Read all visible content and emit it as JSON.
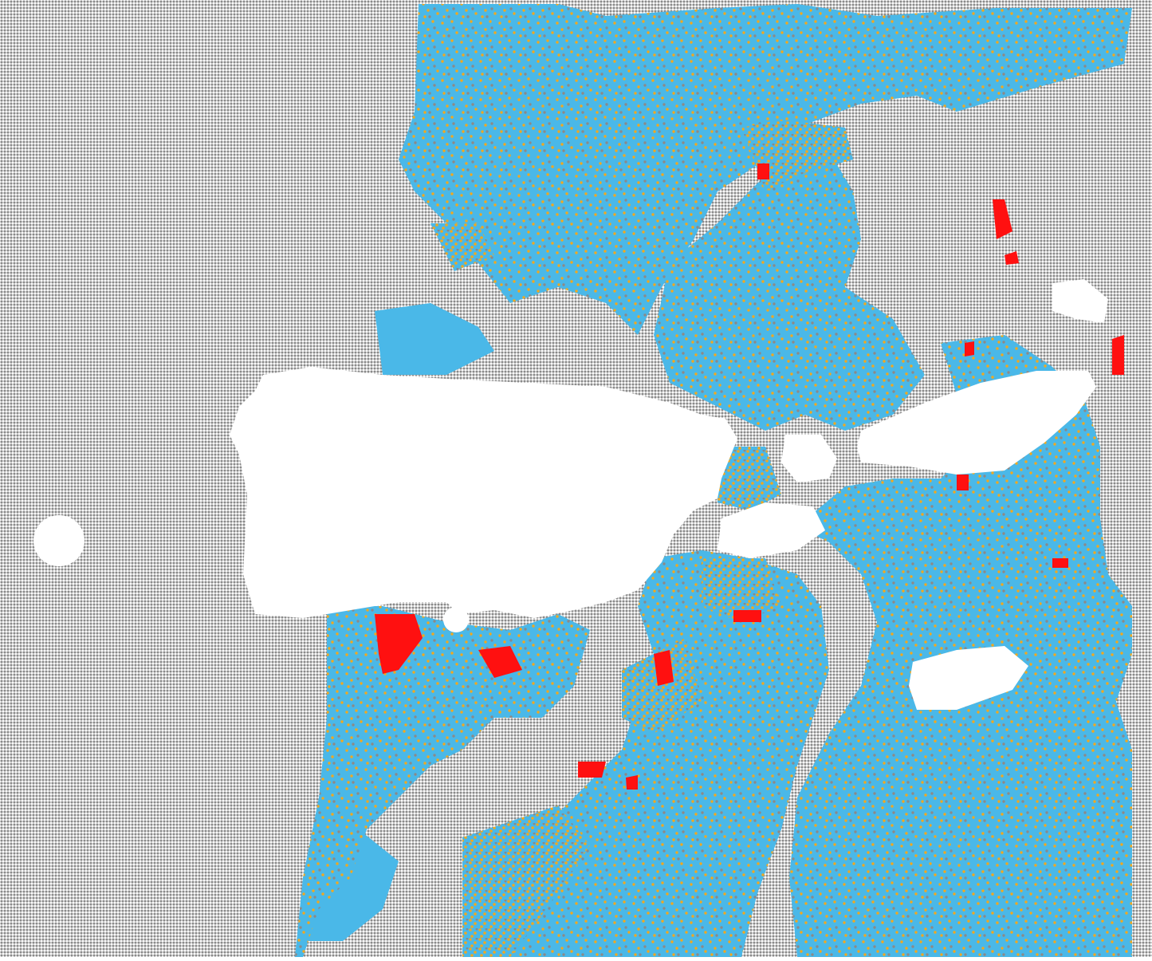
{
  "map": {
    "type": "dot-grid-raster",
    "description_visible_text": "",
    "colors": {
      "background_dots": "#8a8a8a",
      "category_blue": "#4ab8e8",
      "category_orange": "#f0a820",
      "category_red": "#ff1010",
      "gap": "#ffffff"
    },
    "categories": [
      "gray",
      "blue",
      "orange",
      "red"
    ],
    "legend": null,
    "title": null
  }
}
